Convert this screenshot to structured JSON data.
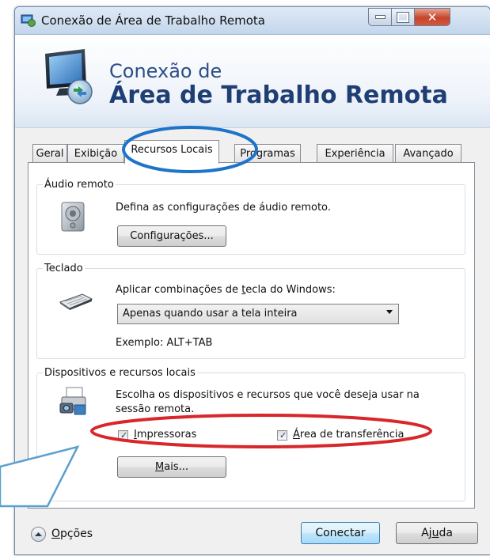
{
  "window": {
    "title": "Conexão de Área de Trabalho Remota"
  },
  "banner": {
    "line1": "Conexão de",
    "line2": "Área de Trabalho Remota"
  },
  "tabs": [
    {
      "label": "Geral"
    },
    {
      "label": "Exibição"
    },
    {
      "label": "Recursos Locais"
    },
    {
      "label": "Programas"
    },
    {
      "label": "Experiência"
    },
    {
      "label": "Avançado"
    }
  ],
  "audio": {
    "legend": "Áudio remoto",
    "description": "Defina as configurações de áudio remoto.",
    "button_pre": "Confi",
    "button_key": "g",
    "button_post": "urações..."
  },
  "keyboard": {
    "legend": "Teclado",
    "desc_pre": "Aplicar combinações de ",
    "desc_key": "t",
    "desc_post": "ecla do Windows:",
    "selected": "Apenas quando usar a tela inteira",
    "example": "Exemplo: ALT+TAB"
  },
  "devices": {
    "legend": "Dispositivos e recursos locais",
    "description_line1": "Escolha os dispositivos e recursos que você deseja usar na",
    "description_line2": "sessão remota.",
    "checkboxes": [
      {
        "key": "I",
        "rest": "mpressoras",
        "checked": true
      },
      {
        "key": "Á",
        "rest": "rea de transferência",
        "checked": true
      }
    ],
    "more_key": "M",
    "more_rest": "ais..."
  },
  "footer": {
    "options_key": "O",
    "options_rest": "pções",
    "connect": "Conectar",
    "help_pre": "Aj",
    "help_key": "u",
    "help_post": "da"
  },
  "colors": {
    "annotation": "#1e74c9",
    "annotation_red": "#d8262a",
    "callout_border": "#5aa0cf"
  }
}
